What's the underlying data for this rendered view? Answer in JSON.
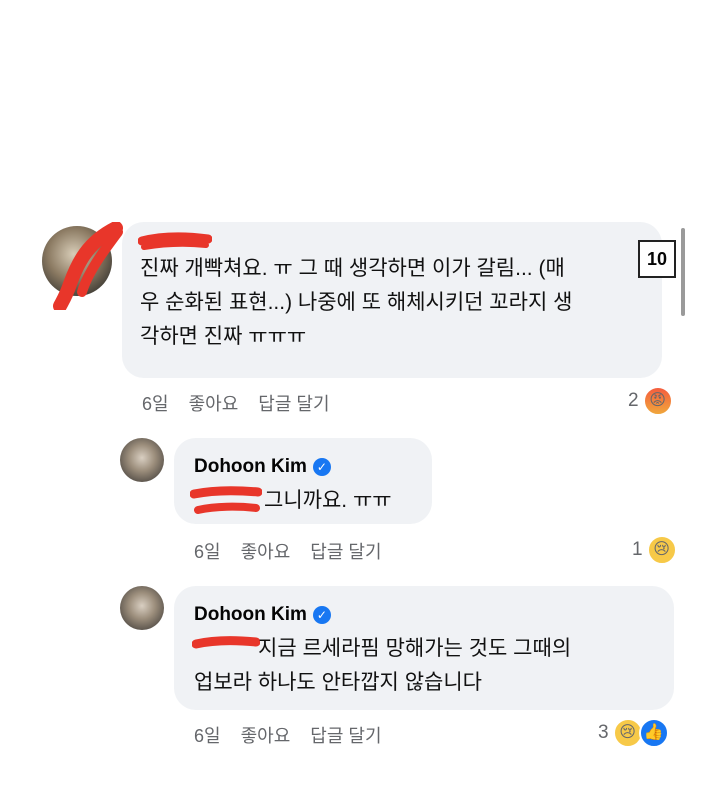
{
  "comments": [
    {
      "author": "",
      "text": "진짜 개빡쳐요. ㅠ 그 때 생각하면 이가 갈림... (매\n우 순화된 표현...) 나중에 또 해체시키던 꼬라지 생\n각하면 진짜 ㅠㅠㅠ",
      "time": "6일",
      "like_label": "좋아요",
      "reply_label": "답글 달기",
      "reaction_count": "2",
      "reactions": [
        "angry-emoji"
      ],
      "badge": "10"
    },
    {
      "author": "Dohoon Kim",
      "verified": true,
      "text": "그니까요. ㅠㅠ",
      "time": "6일",
      "like_label": "좋아요",
      "reply_label": "답글 달기",
      "reaction_count": "1",
      "reactions": [
        "sad-emoji"
      ]
    },
    {
      "author": "Dohoon Kim",
      "verified": true,
      "text": "지금 르세라핌 망해가는 것도 그때의\n업보라 하나도 안타깝지 않습니다",
      "time": "6일",
      "like_label": "좋아요",
      "reply_label": "답글 달기",
      "reaction_count": "3",
      "reactions": [
        "sad-emoji",
        "like-icon"
      ]
    }
  ],
  "colors": {
    "bubble": "#f0f2f5",
    "meta_text": "#65676b",
    "verified": "#1877f2",
    "redaction": "#e8362a"
  }
}
